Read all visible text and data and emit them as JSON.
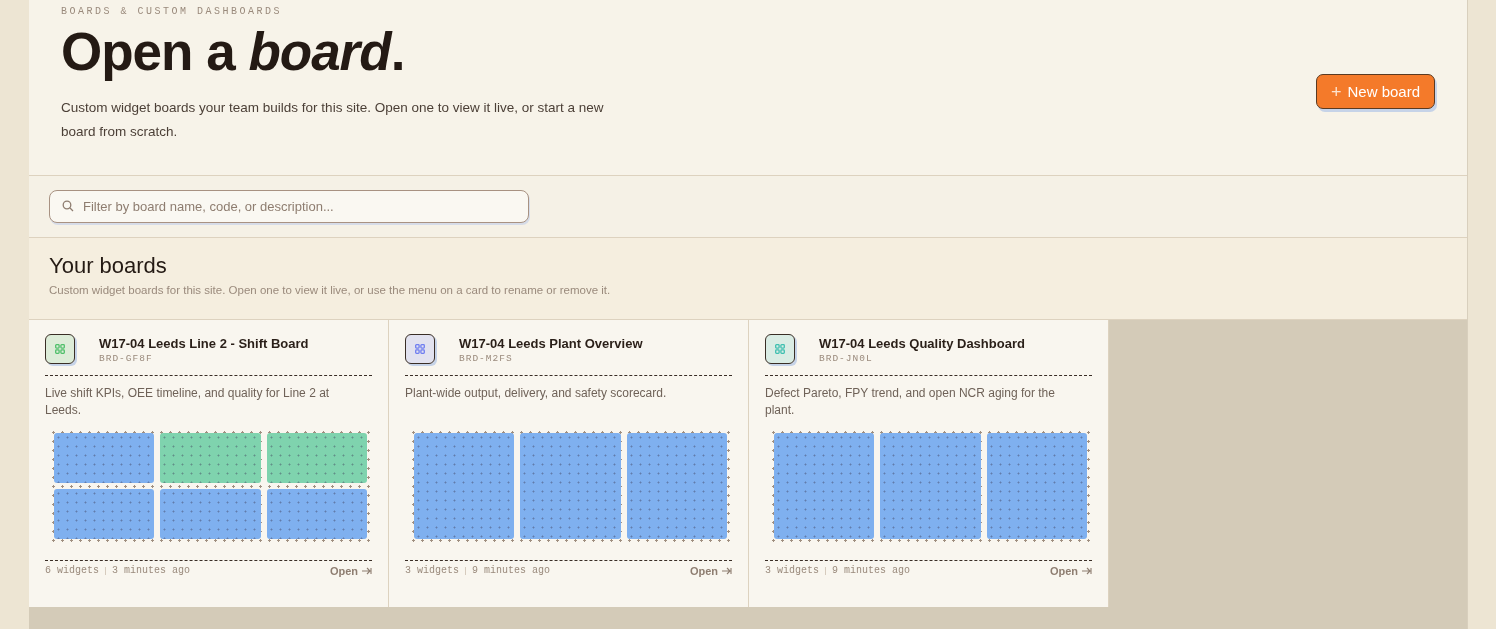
{
  "header": {
    "eyebrow": "BOARDS & CUSTOM DASHBOARDS",
    "title": "Open a *board*.",
    "description": "Custom widget boards your team builds for this site. Open one to view it live, or start a new board from scratch.",
    "new_button": {
      "icon": "+",
      "label": "New board"
    }
  },
  "filter": {
    "placeholder": "Filter by board name, code, or description..."
  },
  "section": {
    "title": "Your boards",
    "subtitle": "Custom widget boards for this site. Open one to view it live, or use the menu on a card to rename or remove it."
  },
  "boards": [
    {
      "name": "W17-04 Leeds Line 2 - Shift Board",
      "code": "BRD-GF8F",
      "color": "#4fbf6a",
      "description": "Live shift KPIs, OEE timeline, and quality for Line 2 at Leeds.",
      "preview": [
        [
          {
            "color": "#7fb0ef"
          },
          {
            "color": "#7fd3ae"
          },
          {
            "color": "#7fd3ae"
          }
        ],
        [
          {
            "color": "#7fb0ef"
          },
          {
            "color": "#7fb0ef"
          },
          {
            "color": "#7fb0ef"
          }
        ]
      ],
      "widgets": "6 widgets",
      "updated": "3 minutes ago",
      "open": "Open"
    },
    {
      "name": "W17-04 Leeds Plant Overview",
      "code": "BRD-M2FS",
      "color": "#6f7ef0",
      "description": "Plant-wide output, delivery, and safety scorecard.",
      "preview": [
        [
          {
            "color": "#7fb0ef"
          },
          {
            "color": "#7fb0ef"
          },
          {
            "color": "#7fb0ef"
          }
        ]
      ],
      "widgets": "3 widgets",
      "updated": "9 minutes ago",
      "open": "Open"
    },
    {
      "name": "W17-04 Leeds Quality Dashboard",
      "code": "BRD-JN0L",
      "color": "#3fbfb0",
      "description": "Defect Pareto, FPY trend, and open NCR aging for the plant.",
      "preview": [
        [
          {
            "color": "#7fb0ef"
          },
          {
            "color": "#7fb0ef"
          },
          {
            "color": "#7fb0ef"
          }
        ]
      ],
      "widgets": "3 widgets",
      "updated": "9 minutes ago",
      "open": "Open"
    }
  ]
}
